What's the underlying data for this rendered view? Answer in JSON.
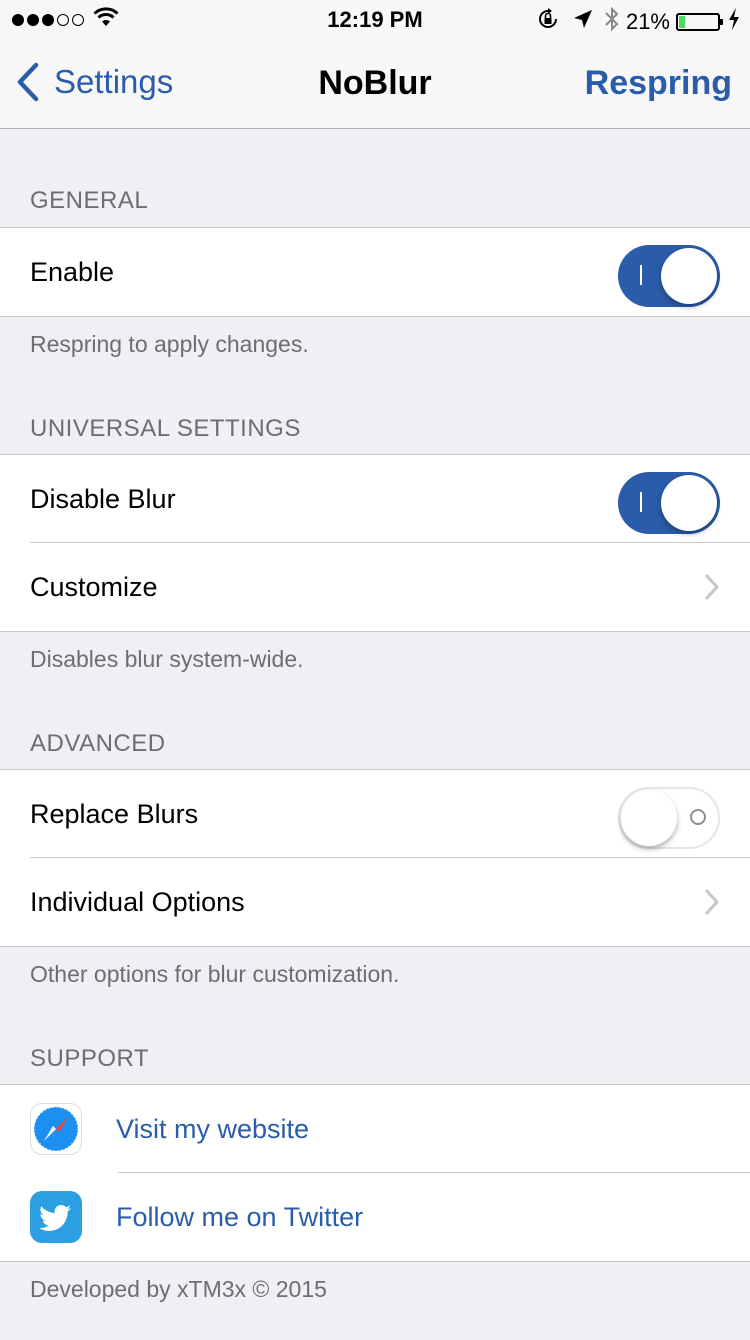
{
  "status_bar": {
    "signal_dots_filled": 3,
    "signal_dots_total": 5,
    "time": "12:19 PM",
    "battery_percent": "21%",
    "battery_level": 0.21
  },
  "nav": {
    "back_label": "Settings",
    "title": "NoBlur",
    "right_label": "Respring"
  },
  "sections": {
    "general": {
      "header": "GENERAL",
      "enable_label": "Enable",
      "enable_on": true,
      "footer": "Respring to apply changes."
    },
    "universal": {
      "header": "UNIVERSAL SETTINGS",
      "disable_blur_label": "Disable Blur",
      "disable_blur_on": true,
      "customize_label": "Customize",
      "footer": "Disables blur system-wide."
    },
    "advanced": {
      "header": "ADVANCED",
      "replace_blurs_label": "Replace Blurs",
      "replace_blurs_on": false,
      "individual_options_label": "Individual Options",
      "footer": "Other options for blur customization."
    },
    "support": {
      "header": "SUPPORT",
      "website_label": "Visit my website",
      "twitter_label": "Follow me on Twitter",
      "footer": "Developed by xTM3x © 2015"
    }
  },
  "colors": {
    "accent": "#2a5caa",
    "background": "#efeff4",
    "battery": "#4cd964"
  },
  "icons": [
    "wifi-icon",
    "rotation-lock-icon",
    "location-arrow-icon",
    "bluetooth-icon",
    "charging-bolt-icon",
    "chevron-right-icon",
    "safari-icon",
    "twitter-icon"
  ]
}
